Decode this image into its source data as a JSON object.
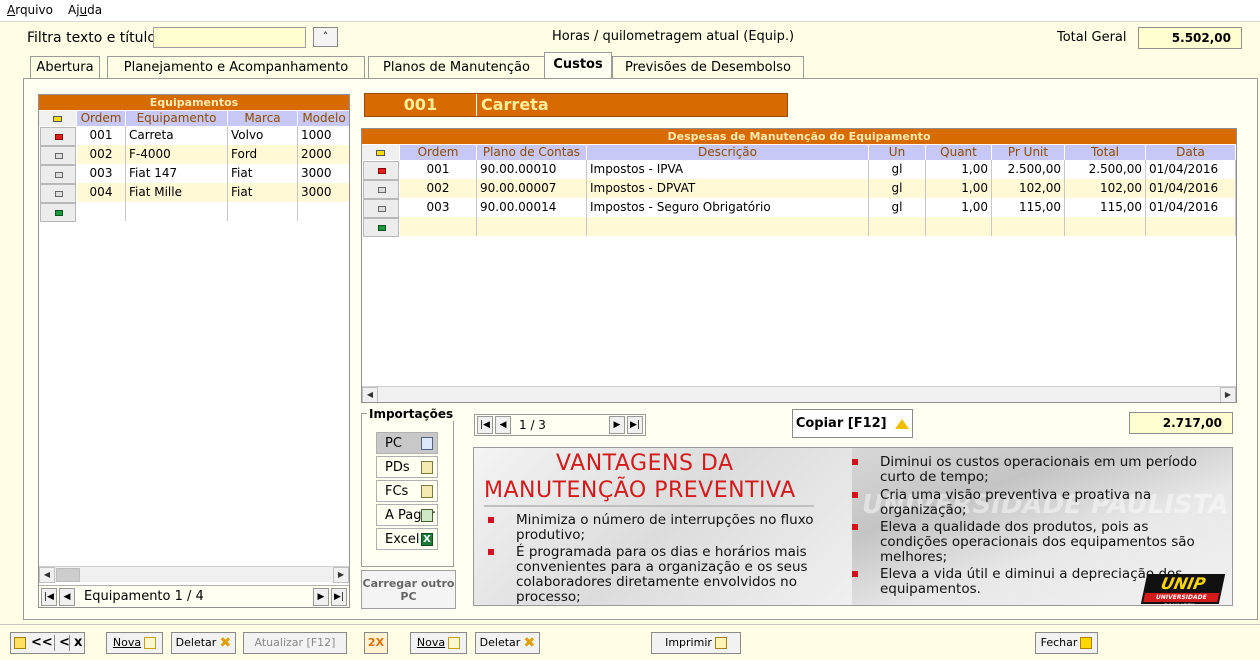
{
  "menu": {
    "arquivo": "Arquivo",
    "ajuda": "Ajuda"
  },
  "header": {
    "filter_label": "Filtra texto e títulos",
    "filter_value": "",
    "sort_btn": "˄",
    "hours_label": "Horas / quilometragem atual (Equip.)",
    "total_label": "Total Geral",
    "total_value": "5.502,00"
  },
  "tabs": [
    "Abertura",
    "Planejamento e Acompanhamento",
    "Planos de Manutenção",
    "Custos",
    "Previsões de Desembolso"
  ],
  "active_tab": "Custos",
  "equipamentos": {
    "title": "Equipamentos",
    "headers": [
      "Ordem",
      "Equipamento",
      "Marca",
      "Modelo"
    ],
    "rows": [
      [
        "001",
        "Carreta",
        "Volvo",
        "1000"
      ],
      [
        "002",
        "F-4000",
        "Ford",
        "2000"
      ],
      [
        "003",
        "Fiat 147",
        "Fiat",
        "3000"
      ],
      [
        "004",
        "Fiat Mille",
        "Fiat",
        "3000"
      ]
    ],
    "nav_label": "Equipamento 1 / 4"
  },
  "selected": {
    "code": "001",
    "name": "Carreta"
  },
  "despesas": {
    "title": "Despesas de Manutenção do Equipamento",
    "headers": [
      "Ordem",
      "Plano de Contas",
      "Descrição",
      "Un",
      "Quant",
      "Pr Unit",
      "Total",
      "Data"
    ],
    "rows": [
      [
        "001",
        "90.00.00010",
        "Impostos - IPVA",
        "gl",
        "1,00",
        "2.500,00",
        "2.500,00",
        "01/04/2016"
      ],
      [
        "002",
        "90.00.00007",
        "Impostos - DPVAT",
        "gl",
        "1,00",
        "102,00",
        "102,00",
        "01/04/2016"
      ],
      [
        "003",
        "90.00.00014",
        "Impostos - Seguro Obrigatório",
        "gl",
        "1,00",
        "115,00",
        "115,00",
        "01/04/2016"
      ]
    ],
    "nav_label": "1 / 3",
    "total": "2.717,00",
    "copy_btn": "Copiar [F12]"
  },
  "importacoes": {
    "title": "Importações",
    "buttons": [
      "PC",
      "PDs",
      "FCs",
      "A Pagar",
      "Excel"
    ],
    "carregar": "Carregar outro PC"
  },
  "banner": {
    "title_line1": "VANTAGENS DA",
    "title_line2": "MANUTENÇÃO PREVENTIVA",
    "left_bullets": [
      "Minimiza o número de interrupções no fluxo produtivo;",
      "É programada para os dias e horários mais convenientes para a organização e os seus colaboradores diretamente envolvidos no processo;"
    ],
    "right_bullets": [
      "Diminui os custos operacionais em um período curto de tempo;",
      "Cria uma visão preventiva e proativa na organização;",
      "Eleva a qualidade dos produtos, pois as condições operacionais dos equipamentos são melhores;",
      "Eleva a vida útil e diminui a depreciação dos equipamentos."
    ],
    "watermark": "UNIVERSIDADE PAULISTA",
    "logo": "UNIP",
    "logo_sub": "UNIVERSIDADE PAULISTA"
  },
  "footer": {
    "first": "<<",
    "prev": "<",
    "close_x": "x",
    "nova1": "Nova",
    "deletar1": "Deletar",
    "atualizar": "Atualizar [F12]",
    "two_x": "2X",
    "nova2": "Nova",
    "deletar2": "Deletar",
    "imprimir": "Imprimir",
    "fechar": "Fechar"
  }
}
